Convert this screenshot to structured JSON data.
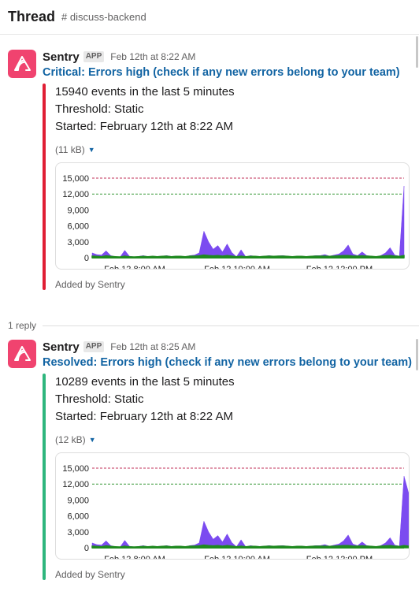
{
  "header": {
    "title": "Thread",
    "channel": "# discuss-backend"
  },
  "messages": [
    {
      "sender": "Sentry",
      "badge": "APP",
      "time": "Feb 12th at 8:22 AM",
      "title": "Critical: Errors high (check if any new errors belong to your team)",
      "bar_color": "#e01e34",
      "lines": [
        "15940 events in the last 5 minutes",
        "Threshold: Static",
        "Started: February 12th at 8:22 AM"
      ],
      "file_size": "(11 kB)",
      "footer": "Added by Sentry"
    },
    {
      "sender": "Sentry",
      "badge": "APP",
      "time": "Feb 12th at 8:25 AM",
      "title": "Resolved: Errors high (check if any new errors belong to your team)",
      "bar_color": "#2eb67d",
      "lines": [
        "10289 events in the last 5 minutes",
        "Threshold: Static",
        "Started: February 12th at 8:22 AM"
      ],
      "file_size": "(12 kB)",
      "footer": "Added by Sentry"
    }
  ],
  "reply_count": "1 reply",
  "chart_data": [
    {
      "type": "area",
      "x_ticks": [
        "Feb 12 8:00 AM",
        "Feb 12 10:00 AM",
        "Feb 12 12:00 PM"
      ],
      "y_ticks": [
        "15,000",
        "12,000",
        "9,000",
        "6,000",
        "3,000",
        "0"
      ],
      "ylim": [
        0,
        15000
      ],
      "thresholds": [
        {
          "value": 15000,
          "color": "#c0305a"
        },
        {
          "value": 12000,
          "color": "#3d9b3d"
        }
      ],
      "series": [
        {
          "color": "#7b4bf0",
          "values": [
            900,
            600,
            500,
            1300,
            400,
            200,
            150,
            1400,
            300,
            150,
            250,
            400,
            200,
            300,
            250,
            300,
            400,
            250,
            300,
            300,
            200,
            400,
            500,
            900,
            5000,
            3000,
            1600,
            2300,
            1100,
            2600,
            1000,
            200,
            1500,
            200,
            400,
            300,
            250,
            300,
            400,
            300,
            350,
            400,
            300,
            200,
            300,
            300,
            250,
            300,
            400,
            400,
            600,
            300,
            500,
            700,
            1300,
            2400,
            700,
            400,
            1100,
            400,
            300,
            200,
            400,
            900,
            1900,
            500,
            300,
            13500
          ]
        },
        {
          "color": "#1f8a1f",
          "values": [
            300,
            250,
            200,
            350,
            250,
            200,
            150,
            300,
            200,
            150,
            200,
            250,
            200,
            250,
            200,
            250,
            300,
            200,
            250,
            250,
            200,
            300,
            300,
            350,
            500,
            400,
            350,
            400,
            300,
            400,
            300,
            200,
            300,
            200,
            250,
            250,
            200,
            250,
            300,
            250,
            300,
            300,
            250,
            200,
            250,
            250,
            200,
            250,
            300,
            300,
            300,
            250,
            300,
            350,
            400,
            400,
            300,
            300,
            350,
            300,
            250,
            200,
            300,
            350,
            400,
            300,
            250,
            400
          ]
        }
      ]
    },
    {
      "type": "area",
      "x_ticks": [
        "Feb 12 8:00 AM",
        "Feb 12 10:00 AM",
        "Feb 12 12:00 PM"
      ],
      "y_ticks": [
        "15,000",
        "12,000",
        "9,000",
        "6,000",
        "3,000",
        "0"
      ],
      "ylim": [
        0,
        15000
      ],
      "thresholds": [
        {
          "value": 15000,
          "color": "#c0305a"
        },
        {
          "value": 12000,
          "color": "#3d9b3d"
        }
      ],
      "series": [
        {
          "color": "#7b4bf0",
          "values": [
            900,
            600,
            500,
            1300,
            400,
            200,
            150,
            1400,
            300,
            150,
            250,
            400,
            200,
            300,
            250,
            300,
            400,
            250,
            300,
            300,
            200,
            400,
            500,
            900,
            5000,
            3000,
            1600,
            2300,
            1100,
            2600,
            1000,
            200,
            1500,
            200,
            400,
            300,
            250,
            300,
            400,
            300,
            350,
            400,
            300,
            200,
            300,
            300,
            250,
            300,
            400,
            400,
            600,
            300,
            500,
            700,
            1300,
            2400,
            700,
            400,
            1100,
            400,
            300,
            200,
            400,
            900,
            1900,
            500,
            300,
            13500,
            10289
          ]
        },
        {
          "color": "#1f8a1f",
          "values": [
            300,
            250,
            200,
            350,
            250,
            200,
            150,
            300,
            200,
            150,
            200,
            250,
            200,
            250,
            200,
            250,
            300,
            200,
            250,
            250,
            200,
            300,
            300,
            350,
            500,
            400,
            350,
            400,
            300,
            400,
            300,
            200,
            300,
            200,
            250,
            250,
            200,
            250,
            300,
            250,
            300,
            300,
            250,
            200,
            250,
            250,
            200,
            250,
            300,
            300,
            300,
            250,
            300,
            350,
            400,
            400,
            300,
            300,
            350,
            300,
            250,
            200,
            300,
            350,
            400,
            300,
            250,
            400,
            300
          ]
        }
      ]
    }
  ]
}
